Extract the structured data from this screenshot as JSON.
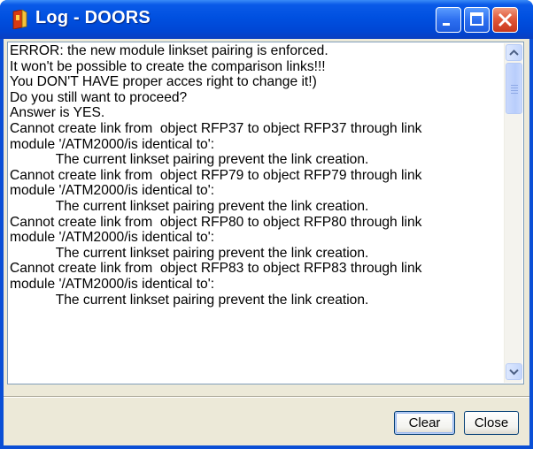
{
  "window": {
    "title": "Log - DOORS",
    "minimize_icon": "minimize-icon",
    "maximize_icon": "maximize-icon",
    "close_icon": "close-icon",
    "app_icon": "doors-app-icon"
  },
  "log": {
    "lines": [
      "ERROR: the new module linkset pairing is enforced.",
      "It won't be possible to create the comparison links!!!",
      "You DON'T HAVE proper acces right to change it!)",
      "Do you still want to proceed?",
      "Answer is YES.",
      "Cannot create link from  object RFP37 to object RFP37 through link",
      "module '/ATM2000/is identical to':",
      "            The current linkset pairing prevent the link creation.",
      "Cannot create link from  object RFP79 to object RFP79 through link",
      "module '/ATM2000/is identical to':",
      "            The current linkset pairing prevent the link creation.",
      "Cannot create link from  object RFP80 to object RFP80 through link",
      "module '/ATM2000/is identical to':",
      "            The current linkset pairing prevent the link creation.",
      "Cannot create link from  object RFP83 to object RFP83 through link",
      "module '/ATM2000/is identical to':",
      "            The current linkset pairing prevent the link creation."
    ]
  },
  "buttons": {
    "clear_label": "Clear",
    "close_label": "Close"
  },
  "colors": {
    "titlebar": "#0050e0",
    "client_bg": "#ece9d8",
    "close_button": "#e1593a"
  }
}
